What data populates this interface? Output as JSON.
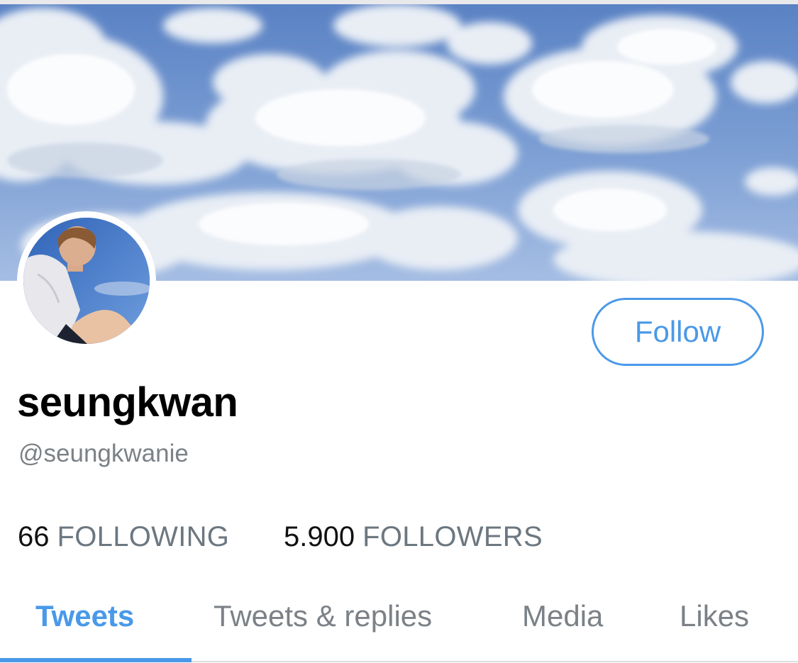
{
  "profile": {
    "display_name": "seungkwan",
    "handle": "@seungkwanie"
  },
  "actions": {
    "follow_label": "Follow"
  },
  "stats": {
    "following_count": "66",
    "following_label": "FOLLOWING",
    "followers_count": "5.900",
    "followers_label": "FOLLOWERS"
  },
  "tabs": [
    {
      "label": "Tweets",
      "active": true
    },
    {
      "label": "Tweets & replies",
      "active": false
    },
    {
      "label": "Media",
      "active": false
    },
    {
      "label": "Likes",
      "active": false
    }
  ],
  "theme": {
    "accent": "#4a99e9",
    "muted_text": "#7b8186",
    "sky_blue": "#6b8fcb",
    "cloud_white": "#f2f5f9"
  }
}
